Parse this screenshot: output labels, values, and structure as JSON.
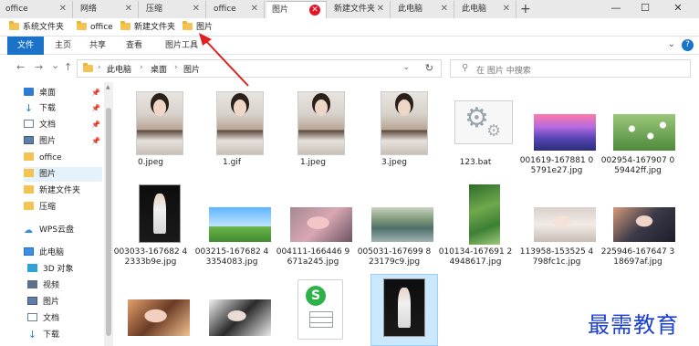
{
  "tabs": [
    {
      "label": "office",
      "active": false
    },
    {
      "label": "网络",
      "active": false
    },
    {
      "label": "压缩",
      "active": false
    },
    {
      "label": "office",
      "active": false
    },
    {
      "label": "图片",
      "active": true
    },
    {
      "label": "新建文件夹",
      "active": false
    },
    {
      "label": "此电脑",
      "active": false
    },
    {
      "label": "此电脑",
      "active": false
    }
  ],
  "new_tab": "+",
  "window_controls": {
    "minimize": "—",
    "maximize": "☐",
    "close": "✕"
  },
  "favorites": [
    "系统文件夹",
    "office",
    "新建文件夹",
    "图片"
  ],
  "ribbon": {
    "tabs": [
      "文件",
      "主页",
      "共享",
      "查看",
      "图片工具"
    ],
    "help": "?"
  },
  "address": {
    "back": "←",
    "forward": "→",
    "dropdown": "⌄",
    "up": "↑",
    "path": [
      "此电脑",
      "桌面",
      "图片"
    ],
    "refresh": "↻"
  },
  "search": {
    "placeholder": "在 图片 中搜索"
  },
  "sidebar": {
    "items": [
      {
        "label": "桌面",
        "icon": "desktop-icon",
        "pinned": true
      },
      {
        "label": "下载",
        "icon": "download-icon",
        "pinned": true
      },
      {
        "label": "文档",
        "icon": "document-icon",
        "pinned": true
      },
      {
        "label": "图片",
        "icon": "pictures-icon",
        "pinned": true
      },
      {
        "label": "office",
        "icon": "folder-icon",
        "pinned": false
      },
      {
        "label": "图片",
        "icon": "folder-icon",
        "pinned": false,
        "selected": true
      },
      {
        "label": "新建文件夹",
        "icon": "folder-icon",
        "pinned": false
      },
      {
        "label": "压缩",
        "icon": "folder-icon",
        "pinned": false
      },
      {
        "label": "WPS云盘",
        "icon": "cloud-icon",
        "pinned": false
      },
      {
        "label": "此电脑",
        "icon": "computer-icon",
        "pinned": false
      },
      {
        "label": "3D 对象",
        "icon": "3d-objects-icon",
        "pinned": false
      },
      {
        "label": "视频",
        "icon": "video-icon",
        "pinned": false
      },
      {
        "label": "图片",
        "icon": "pictures-icon",
        "pinned": false
      },
      {
        "label": "文档",
        "icon": "document-icon",
        "pinned": false
      },
      {
        "label": "下载",
        "icon": "download-icon",
        "pinned": false
      }
    ]
  },
  "files": [
    {
      "name": "0.jpeg",
      "thumb": "portrait"
    },
    {
      "name": "1.gif",
      "thumb": "portrait"
    },
    {
      "name": "1.jpeg",
      "thumb": "portrait"
    },
    {
      "name": "3.jpeg",
      "thumb": "portrait"
    },
    {
      "name": "123.bat",
      "thumb": "bat"
    },
    {
      "name": "001619-167881 05791e27.jpg",
      "thumb": "landscape-purple"
    },
    {
      "name": "002954-167907 059442ff.jpg",
      "thumb": "landscape-flower"
    },
    {
      "name": "003033-167682 42333b9e.jpg",
      "thumb": "fig-dark"
    },
    {
      "name": "003215-167682 43354083.jpg",
      "thumb": "landscape-sky"
    },
    {
      "name": "004111-166446 9671a245.jpg",
      "thumb": "landscape-girl-pink"
    },
    {
      "name": "005031-167699 823179c9.jpg",
      "thumb": "landscape-lake"
    },
    {
      "name": "010134-167691 24948617.jpg",
      "thumb": "landscape-terrace"
    },
    {
      "name": "113958-153525 4798fc1c.jpg",
      "thumb": "landscape-girl-white"
    },
    {
      "name": "225946-167647 318697af.jpg",
      "thumb": "landscape-girl-anime"
    },
    {
      "name": "",
      "thumb": "landscape-girl-warm"
    },
    {
      "name": "",
      "thumb": "landscape-girl-bw"
    },
    {
      "name": "",
      "thumb": "xls"
    },
    {
      "name": "",
      "thumb": "fig-dark"
    }
  ],
  "watermark": "最需教育",
  "colors": {
    "accent": "#1a73c9",
    "annotation_arrow": "#e02020",
    "close_tab": "#e81123",
    "watermark": "#1a3fd1"
  }
}
